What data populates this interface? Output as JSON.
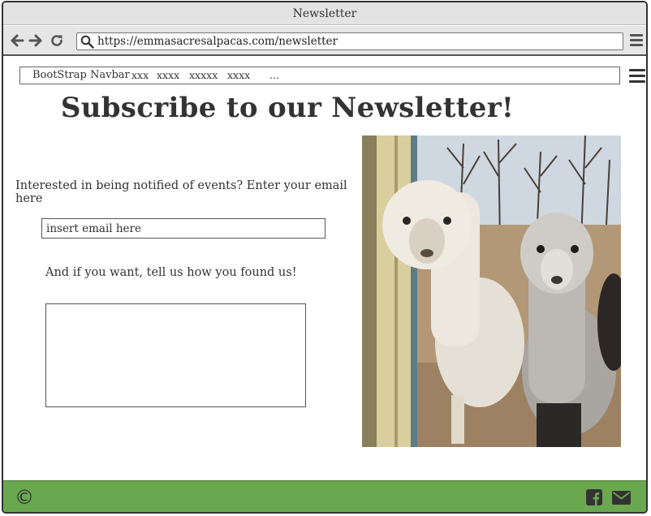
{
  "window": {
    "title": "Newsletter"
  },
  "browser": {
    "url": "https://emmasacresalpacas.com/newsletter",
    "icons": [
      "back-arrow-icon",
      "forward-arrow-icon",
      "reload-icon",
      "search-icon",
      "menu-icon"
    ]
  },
  "navbar": {
    "brand": "BootStrap Navbar",
    "links": [
      "xxx",
      "xxxx",
      "xxxxx",
      "xxxx",
      "..."
    ]
  },
  "main": {
    "title": "Subscribe to our Newsletter!",
    "intro": "Interested in being notified of events? Enter your email here",
    "email_placeholder": "insert email here",
    "found_label": "And if you want, tell us how you found us!",
    "found_value": ""
  },
  "footer": {
    "copyright": "©",
    "icons": [
      "facebook-icon",
      "email-icon"
    ],
    "color": "#6aa84f"
  }
}
